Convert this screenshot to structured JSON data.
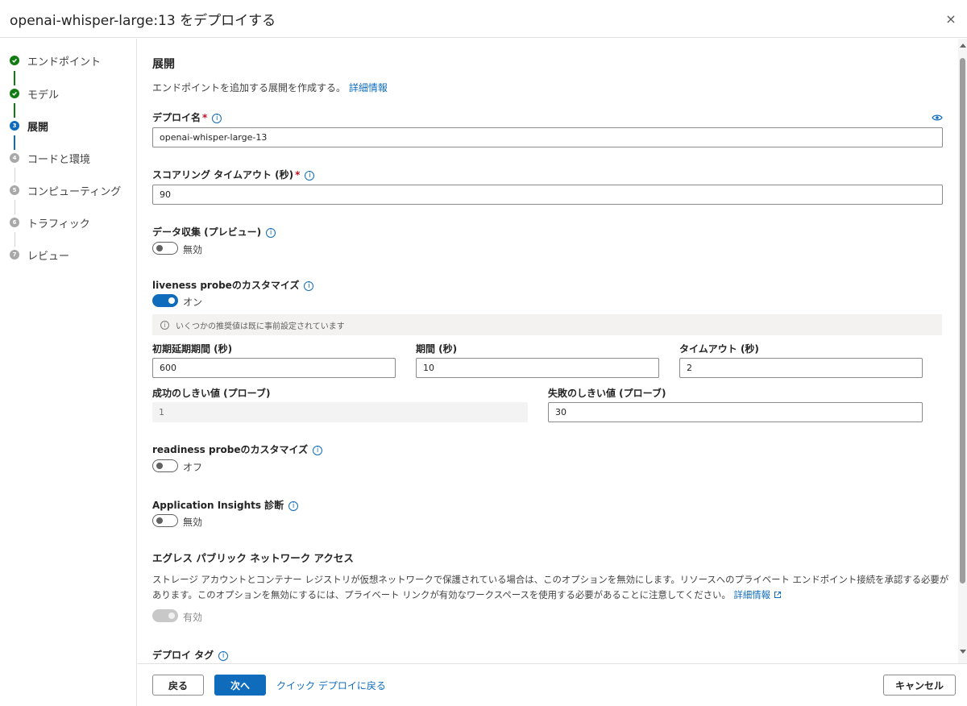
{
  "header": {
    "title": "openai-whisper-large:13 をデプロイする",
    "close_icon": "×"
  },
  "steps": [
    {
      "number": "",
      "label": "エンドポイント",
      "state": "done"
    },
    {
      "number": "",
      "label": "モデル",
      "state": "done"
    },
    {
      "number": "3",
      "label": "展開",
      "state": "current"
    },
    {
      "number": "4",
      "label": "コードと環境",
      "state": "todo"
    },
    {
      "number": "5",
      "label": "コンピューティング",
      "state": "todo"
    },
    {
      "number": "6",
      "label": "トラフィック",
      "state": "todo"
    },
    {
      "number": "7",
      "label": "レビュー",
      "state": "todo"
    }
  ],
  "main": {
    "section_title": "展開",
    "description": "エンドポイントを追加する展開を作成する。",
    "description_link": "詳細情報",
    "deploy_name": {
      "label": "デプロイ名",
      "required": "*",
      "value": "openai-whisper-large-13"
    },
    "scoring_timeout": {
      "label": "スコアリング タイムアウト (秒)",
      "required": "*",
      "value": "90"
    },
    "data_collection": {
      "label": "データ収集 (プレビュー)",
      "state": "無効",
      "on": false
    },
    "liveness": {
      "label": "liveness probeのカスタマイズ",
      "state": "オン",
      "on": true,
      "info_text": "いくつかの推奨値は既に事前設定されています",
      "initial_delay": {
        "label": "初期延期期間 (秒)",
        "value": "600"
      },
      "period": {
        "label": "期間 (秒)",
        "value": "10"
      },
      "timeout": {
        "label": "タイムアウト (秒)",
        "value": "2"
      },
      "success_threshold": {
        "label": "成功のしきい値 (プローブ)",
        "value": "1"
      },
      "failure_threshold": {
        "label": "失敗のしきい値 (プローブ)",
        "value": "30"
      }
    },
    "readiness": {
      "label": "readiness probeのカスタマイズ",
      "state": "オフ",
      "on": false
    },
    "app_insights": {
      "label": "Application Insights 診断",
      "state": "無効",
      "on": false
    },
    "egress": {
      "title": "エグレス パブリック ネットワーク アクセス",
      "desc_line1": "ストレージ アカウントとコンテナー レジストリが仮想ネットワークで保護されている場合は、このオプションを無効にします。リソースへのプライベート エンドポイント接続を承認する必要が",
      "desc_line2": "あります。このオプションを無効にするには、プライベート リンクが有効なワークスペースを使用する必要があることに注意してください。",
      "link": "詳細情報",
      "state": "有効"
    },
    "deploy_tags": {
      "label": "デプロイ タグ"
    }
  },
  "footer": {
    "back": "戻る",
    "next": "次へ",
    "quick_link": "クイック デプロイに戻る",
    "cancel": "キャンセル"
  },
  "colors": {
    "accent": "#0f6cbd",
    "success": "#107c10",
    "required": "#c50f1f"
  }
}
